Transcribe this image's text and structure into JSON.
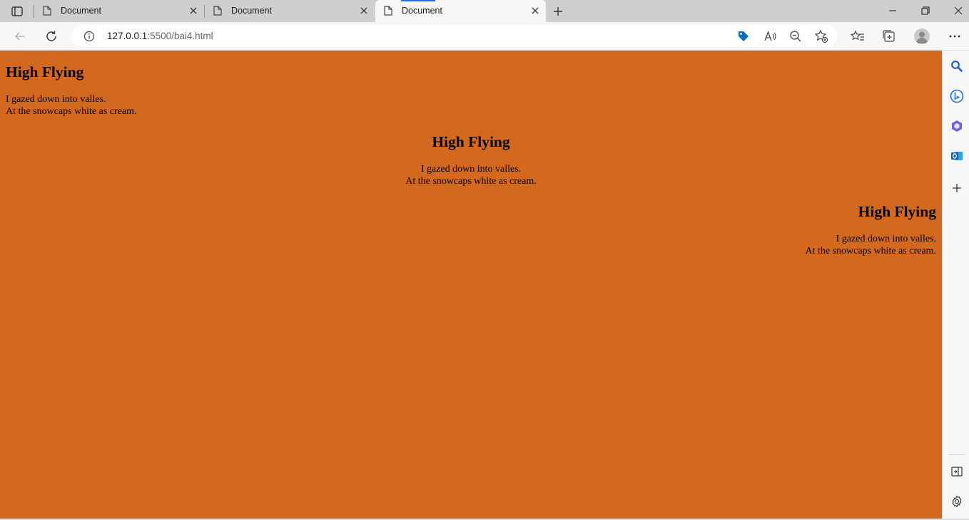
{
  "tabs": [
    {
      "title": "Document"
    },
    {
      "title": "Document"
    },
    {
      "title": "Document",
      "active": true
    }
  ],
  "address": {
    "host": "127.0.0.1",
    "path": ":5500/bai4.html"
  },
  "page": {
    "background": "#d2691e",
    "blocks": [
      {
        "align": "left",
        "heading": "High Flying",
        "line1": "I gazed down into valles.",
        "line2": "At the snowcaps white as cream."
      },
      {
        "align": "center",
        "heading": "High Flying",
        "line1": "I gazed down into valles.",
        "line2": "At the snowcaps white as cream."
      },
      {
        "align": "right",
        "heading": "High Flying",
        "line1": "I gazed down into valles.",
        "line2": "At the snowcaps white as cream."
      }
    ]
  },
  "icons": {
    "tab_actions": "tab-actions-icon",
    "document": "document-icon",
    "close": "close-icon",
    "new_tab": "plus-icon",
    "back": "back-arrow-icon",
    "refresh": "refresh-icon",
    "info": "info-icon",
    "shopping": "tag-icon",
    "read_aloud": "read-aloud-icon",
    "zoom": "zoom-out-icon",
    "add_favorite": "star-add-icon",
    "favorites": "favorites-icon",
    "collections": "collections-icon",
    "profile": "avatar",
    "more": "more-icon",
    "sidebar_search": "search-icon",
    "sidebar_bing": "bing-icon",
    "sidebar_copilot": "office-icon",
    "sidebar_outlook": "outlook-icon",
    "sidebar_add": "plus-icon",
    "sidebar_hide": "hide-sidebar-icon",
    "sidebar_settings": "gear-icon"
  },
  "colors": {
    "accent": "#1a73e8",
    "tag": "#0f6cbd",
    "outlook": "#0a64ad"
  }
}
